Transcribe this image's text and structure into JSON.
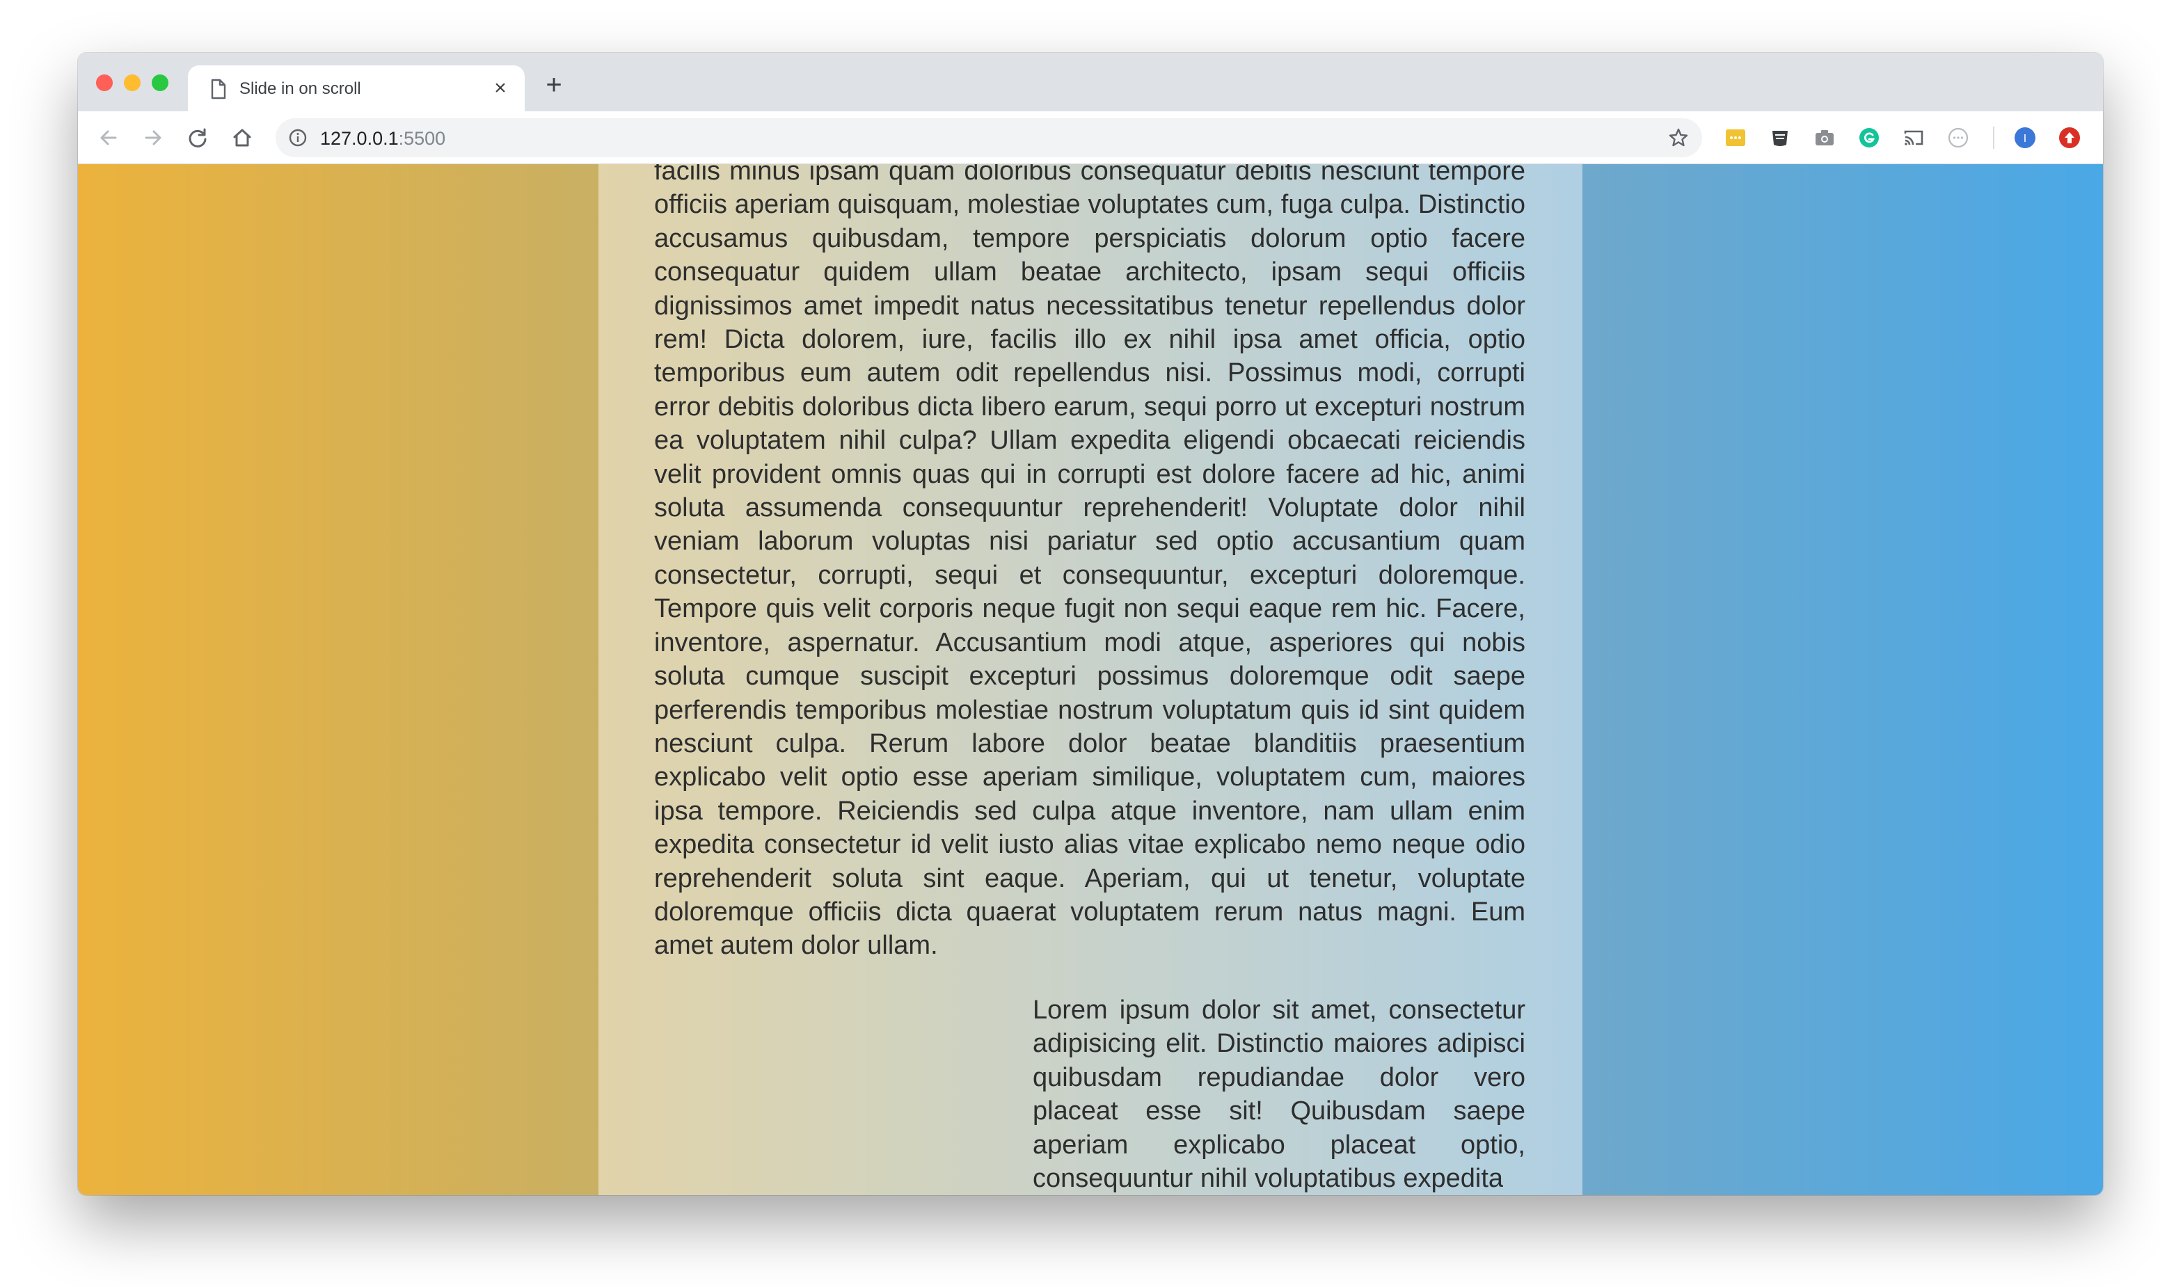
{
  "browser": {
    "tab_title": "Slide in on scroll",
    "url_host": "127.0.0.1",
    "url_port": ":5500",
    "new_tab_label": "+",
    "tab_close_label": "×",
    "profile_initial": "I"
  },
  "colors": {
    "gradient_start": "#ecb23c",
    "gradient_end": "#4aa8e6",
    "text": "#2e2e2e"
  },
  "icons": {
    "toolbar": [
      "back-arrow-icon",
      "forward-arrow-icon",
      "reload-icon",
      "home-icon",
      "site-info-icon",
      "bookmark-star-icon"
    ],
    "extensions": [
      "sticky-note-extension-icon",
      "pocket-extension-icon",
      "camera-extension-icon",
      "grammarly-extension-icon",
      "cast-icon",
      "ellipsis-extension-icon",
      "profile-avatar-icon",
      "update-arrow-icon"
    ]
  },
  "page": {
    "paragraphs": [
      "facilis minus ipsam quam doloribus consequatur debitis nesciunt tempore officiis aperiam quisquam, molestiae voluptates cum, fuga culpa. Distinctio accusamus quibusdam, tempore perspiciatis dolorum optio facere consequatur quidem ullam beatae architecto, ipsam sequi officiis dignissimos amet impedit natus necessitatibus tenetur repellendus dolor rem! Dicta dolorem, iure, facilis illo ex nihil ipsa amet officia, optio temporibus eum autem odit repellendus nisi. Possimus modi, corrupti error debitis doloribus dicta libero earum, sequi porro ut excepturi nostrum ea voluptatem nihil culpa? Ullam expedita eligendi obcaecati reiciendis velit provident omnis quas qui in corrupti est dolore facere ad hic, animi soluta assumenda consequuntur reprehenderit! Voluptate dolor nihil veniam laborum voluptas nisi pariatur sed optio accusantium quam consectetur, corrupti, sequi et consequuntur, excepturi doloremque. Tempore quis velit corporis neque fugit non sequi eaque rem hic. Facere, inventore, aspernatur. Accusantium modi atque, asperiores qui nobis soluta cumque suscipit excepturi possimus doloremque odit saepe perferendis temporibus molestiae nostrum voluptatum quis id sint quidem nesciunt culpa. Rerum labore dolor beatae blanditiis praesentium explicabo velit optio esse aperiam similique, voluptatem cum, maiores ipsa tempore. Reiciendis sed culpa atque inventore, nam ullam enim expedita consectetur id velit iusto alias vitae explicabo nemo neque odio reprehenderit soluta sint eaque. Aperiam, qui ut tenetur, voluptate doloremque officiis dicta quaerat voluptatem rerum natus magni. Eum amet autem dolor ullam.",
      "Lorem ipsum dolor sit amet, consectetur adipisicing elit. Distinctio maiores adipisci quibusdam repudiandae dolor vero placeat esse sit! Quibusdam saepe aperiam explicabo placeat optio, consequuntur nihil voluptatibus expedita"
    ]
  }
}
